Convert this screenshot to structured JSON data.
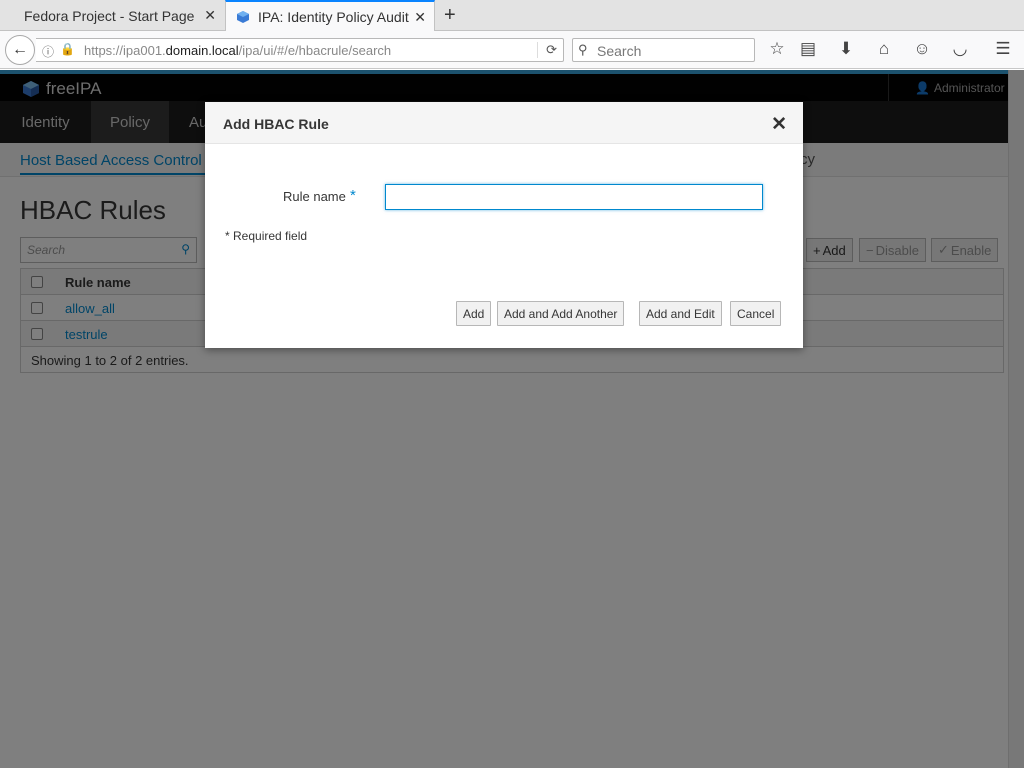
{
  "browser": {
    "tabs": [
      {
        "title": "Fedora Project - Start Page"
      },
      {
        "title": "IPA: Identity Policy Audit"
      }
    ],
    "url_prefix": "https://ipa001.",
    "url_domain": "domain.local",
    "url_suffix": "/ipa/ui/#/e/hbacrule/search",
    "search_placeholder": "Search"
  },
  "app": {
    "brand": "freeIPA",
    "user": "Administrator",
    "menu": [
      "Identity",
      "Policy",
      "Au"
    ],
    "subnav": "Host Based Access Control",
    "subnav_right": "cy",
    "page_title": "HBAC Rules",
    "search_placeholder": "Search",
    "actions": {
      "add": "Add",
      "disable": "Disable",
      "enable": "Enable"
    },
    "table": {
      "header": "Rule name",
      "rows": [
        {
          "name": "allow_all"
        },
        {
          "name": "testrule"
        }
      ],
      "footer": "Showing 1 to 2 of 2 entries."
    }
  },
  "dialog": {
    "title": "Add HBAC Rule",
    "field_label": "Rule name",
    "required_mark": "*",
    "field_value": "",
    "required_note": "* Required field",
    "buttons": {
      "add": "Add",
      "add_another": "Add and Add Another",
      "add_edit": "Add and Edit",
      "cancel": "Cancel"
    }
  },
  "colors": {
    "accent": "#0088ce",
    "top_band": "#39a5dc",
    "menubar": "#1d1d1d"
  }
}
